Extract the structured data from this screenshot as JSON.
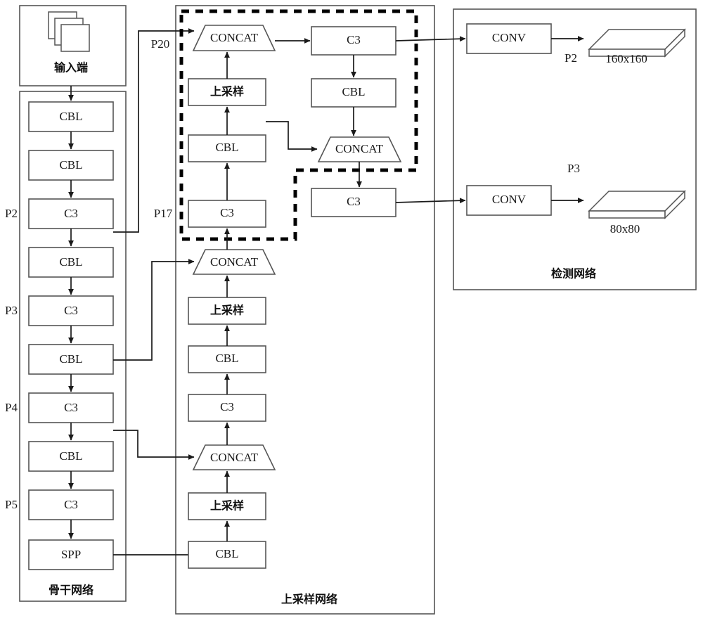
{
  "diagram": {
    "title": "YOLO-style network architecture diagram",
    "stroke_color": "#555555",
    "line_color": "#1a1a1a",
    "dashed_color": "#000000"
  },
  "backbone": {
    "footer": "骨干网络",
    "input_label": "输入端",
    "blocks": [
      {
        "label": "CBL"
      },
      {
        "label": "CBL"
      },
      {
        "label": "C3"
      },
      {
        "label": "CBL"
      },
      {
        "label": "C3"
      },
      {
        "label": "CBL"
      },
      {
        "label": "C3"
      },
      {
        "label": "CBL"
      },
      {
        "label": "C3"
      },
      {
        "label": "SPP"
      }
    ],
    "stage_tags": [
      {
        "label": "P2"
      },
      {
        "label": "P3"
      },
      {
        "label": "P4"
      },
      {
        "label": "P5"
      }
    ]
  },
  "upsample": {
    "footer": "上采样网络",
    "left_chain": [
      {
        "label": "CBL"
      },
      {
        "label": "上采样"
      },
      {
        "label": "CONCAT"
      },
      {
        "label": "C3"
      },
      {
        "label": "CBL"
      },
      {
        "label": "上采样"
      },
      {
        "label": "CONCAT"
      },
      {
        "label": "C3"
      },
      {
        "label": "CBL"
      },
      {
        "label": "上采样"
      },
      {
        "label": "CONCAT"
      }
    ],
    "right_chain": [
      {
        "label": "C3"
      },
      {
        "label": "CBL"
      },
      {
        "label": "CONCAT"
      },
      {
        "label": "C3"
      }
    ],
    "tags": [
      {
        "label": "P20"
      },
      {
        "label": "P17"
      }
    ]
  },
  "detection": {
    "footer": "检测网络",
    "branches": [
      {
        "conv_label": "CONV",
        "tag": "P2",
        "size": "160x160"
      },
      {
        "conv_label": "CONV",
        "tag": "P3",
        "size": "80x80"
      }
    ]
  }
}
